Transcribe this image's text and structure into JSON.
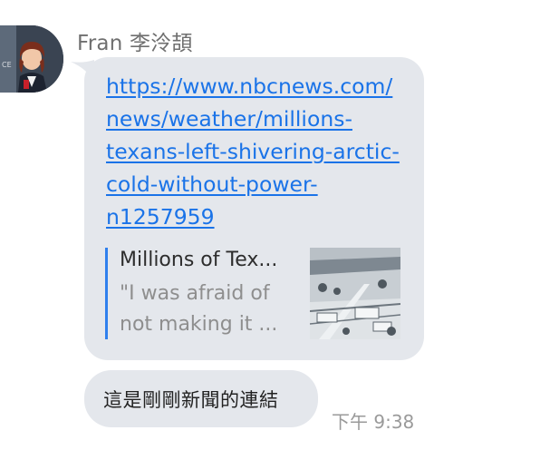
{
  "message_group": {
    "sender": {
      "name": "Fran 李泠頡",
      "avatar_icon": "user-avatar-photo"
    },
    "link_message": {
      "url_lines": [
        "https://www.nbcnews.com/",
        "news/weather/millions-",
        "texans-left-shivering-arctic-",
        "cold-without-power-",
        "n1257959"
      ],
      "preview": {
        "title": "Millions of Tex...",
        "description_lines": [
          "\"I was afraid of",
          "not making it ..."
        ],
        "thumbnail_icon": "snowy-city-aerial-thumbnail"
      }
    },
    "text_message": {
      "text": "這是剛剛新聞的連結",
      "timestamp": "下午 9:38"
    }
  },
  "colors": {
    "bubble_background": "#e4e7ec",
    "link": "#1a73e8",
    "preview_accent_bar": "#2f80ed",
    "sender_name": "#6f6f6f",
    "timestamp": "#9a9a9a"
  }
}
